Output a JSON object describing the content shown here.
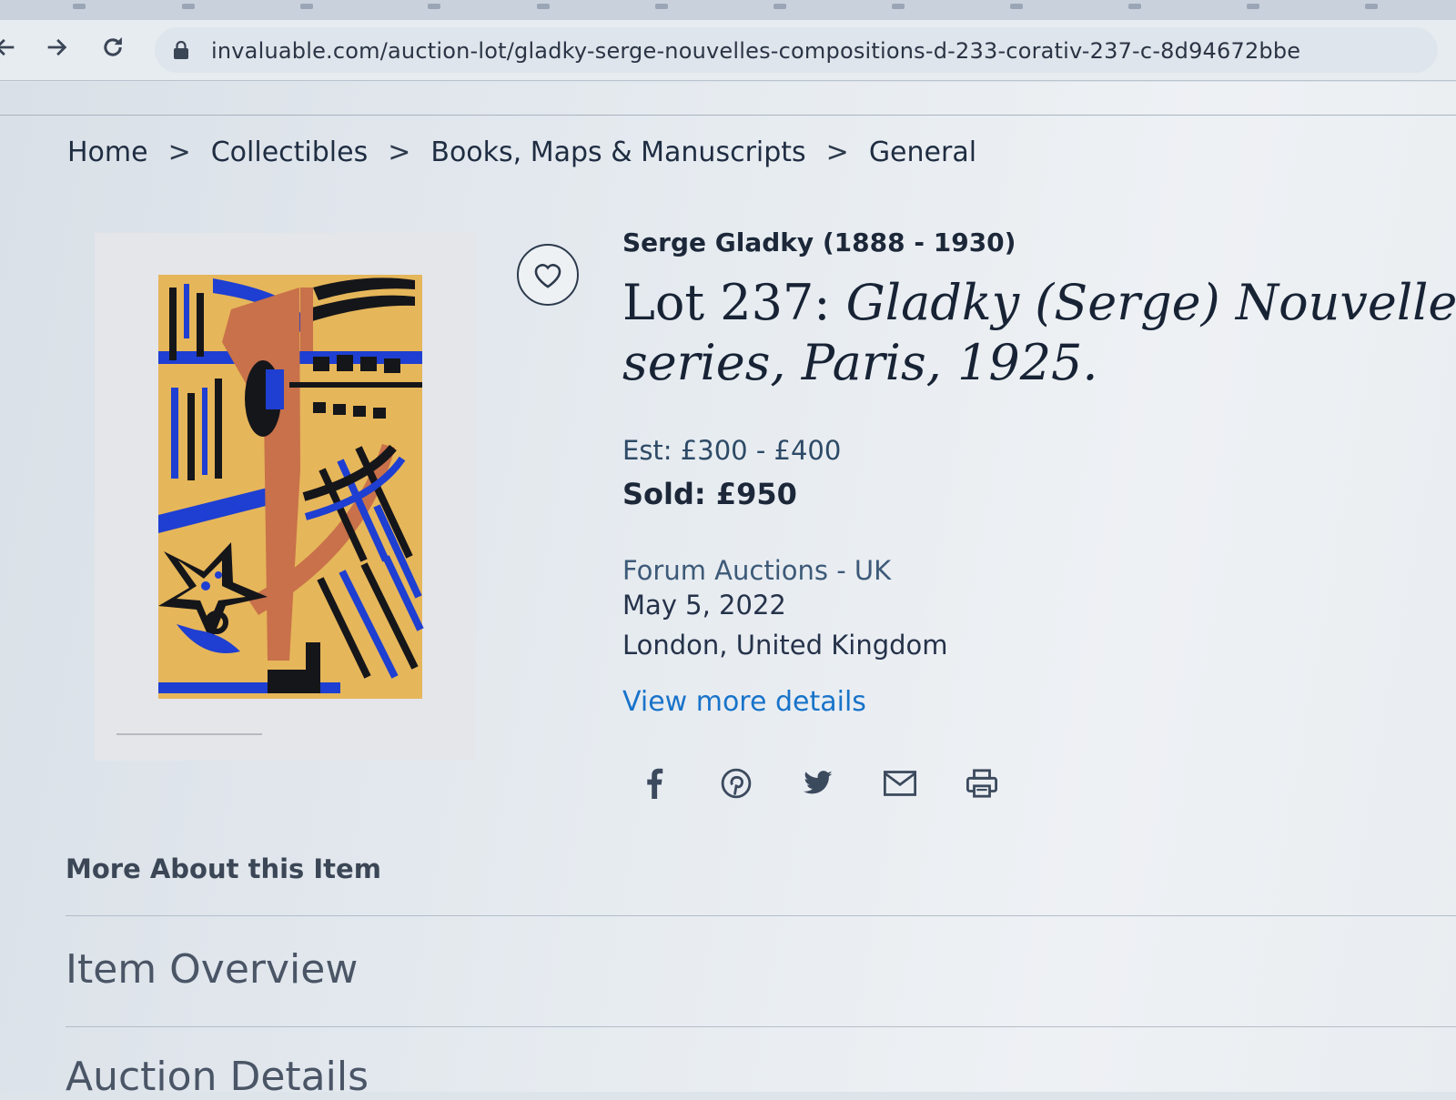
{
  "browser": {
    "url": "invaluable.com/auction-lot/gladky-serge-nouvelles-compositions-d-233-corativ-237-c-8d94672bbe"
  },
  "breadcrumb": [
    "Home",
    "Collectibles",
    "Books, Maps & Manuscripts",
    "General"
  ],
  "breadcrumb_separator": ">",
  "lot": {
    "artist": "Serge Gladky (1888 - 1930)",
    "lot_label": "Lot 237: ",
    "title_line1": "Gladky (Serge) Nouvelles",
    "title_line2": "series, Paris, 1925.",
    "estimate": "Est: £300 - £400",
    "sold": "Sold:  £950",
    "auction_house": "Forum Auctions - UK",
    "date": "May 5, 2022",
    "location": "London, United Kingdom",
    "details_link": "View more details"
  },
  "share_icons": [
    "facebook-icon",
    "pinterest-icon",
    "twitter-icon",
    "email-icon",
    "print-icon"
  ],
  "sections": {
    "more_about": "More About this Item",
    "overview": "Item Overview",
    "auction_details": "Auction Details"
  },
  "colors": {
    "link": "#1873c9",
    "artwork_ochre": "#e6b65a",
    "artwork_blue": "#1e3fd1",
    "artwork_terracotta": "#c8714a",
    "artwork_black": "#15161a"
  }
}
